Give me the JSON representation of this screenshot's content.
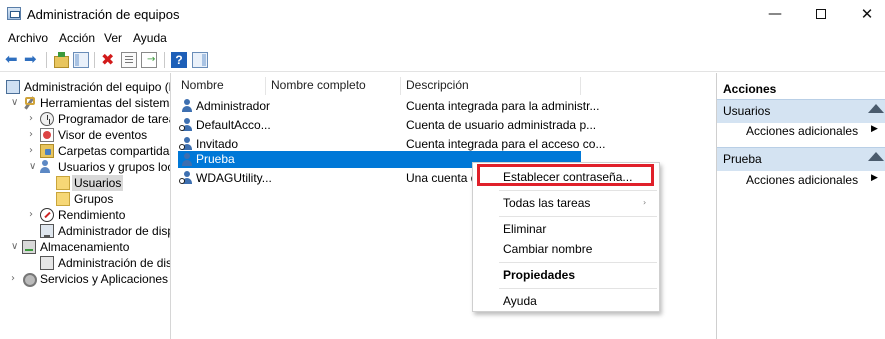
{
  "window": {
    "title": "Administración de equipos",
    "min_glyph": "—",
    "close_glyph": "✕"
  },
  "menu": [
    "Archivo",
    "Acción",
    "Ver",
    "Ayuda"
  ],
  "toolbar": {
    "back_glyph": "⬅",
    "forward_glyph": "➡",
    "delete_glyph": "✖",
    "help_glyph": "?"
  },
  "tree": {
    "items": [
      {
        "label": "Administración del equipo (loca",
        "expander": "",
        "icon": "computer-icon"
      },
      {
        "label": "Herramientas del sistema",
        "expander": "∨",
        "icon": "tools-icon"
      },
      {
        "label": "Programador de tareas",
        "expander": "›",
        "icon": "clock-icon"
      },
      {
        "label": "Visor de eventos",
        "expander": "›",
        "icon": "event-viewer-icon"
      },
      {
        "label": "Carpetas compartidas",
        "expander": "›",
        "icon": "shared-folder-icon"
      },
      {
        "label": "Usuarios y grupos locale",
        "expander": "∨",
        "icon": "users-icon"
      },
      {
        "label": "Usuarios",
        "expander": "",
        "icon": "folder-icon"
      },
      {
        "label": "Grupos",
        "expander": "",
        "icon": "folder-icon"
      },
      {
        "label": "Rendimiento",
        "expander": "›",
        "icon": "performance-icon"
      },
      {
        "label": "Administrador de dispos",
        "expander": "",
        "icon": "device-manager-icon"
      },
      {
        "label": "Almacenamiento",
        "expander": "∨",
        "icon": "storage-icon"
      },
      {
        "label": "Administración de disco",
        "expander": "",
        "icon": "disk-icon"
      },
      {
        "label": "Servicios y Aplicaciones",
        "expander": "›",
        "icon": "services-icon"
      }
    ]
  },
  "list": {
    "columns": [
      "Nombre",
      "Nombre completo",
      "Descripción"
    ],
    "rows": [
      {
        "name": "Administrador",
        "full_name": "",
        "description": "Cuenta integrada para la administr..."
      },
      {
        "name": "DefaultAcco...",
        "full_name": "",
        "description": "Cuenta de usuario administrada p..."
      },
      {
        "name": "Invitado",
        "full_name": "",
        "description": "Cuenta integrada para el acceso co..."
      },
      {
        "name": "Prueba",
        "full_name": "",
        "description": ""
      },
      {
        "name": "WDAGUtility...",
        "full_name": "",
        "description": "Una cuenta de"
      }
    ],
    "selected_row": "Prueba",
    "selection_color": "#0078d7"
  },
  "actions": {
    "header": "Acciones",
    "sections": [
      {
        "title": "Usuarios",
        "item": "Acciones adicionales",
        "arrow": "▶"
      },
      {
        "title": "Prueba",
        "item": "Acciones adicionales",
        "arrow": "▶"
      }
    ]
  },
  "context_menu": {
    "items": [
      {
        "label": "Establecer contraseña...",
        "highlighted": true
      },
      {
        "label": "Todas las tareas",
        "submenu": true,
        "submenu_arrow": "›"
      },
      {
        "label": "Eliminar"
      },
      {
        "label": "Cambiar nombre"
      },
      {
        "label": "Propiedades",
        "bold": true
      },
      {
        "label": "Ayuda"
      }
    ],
    "highlight_color": "#e0202a"
  }
}
